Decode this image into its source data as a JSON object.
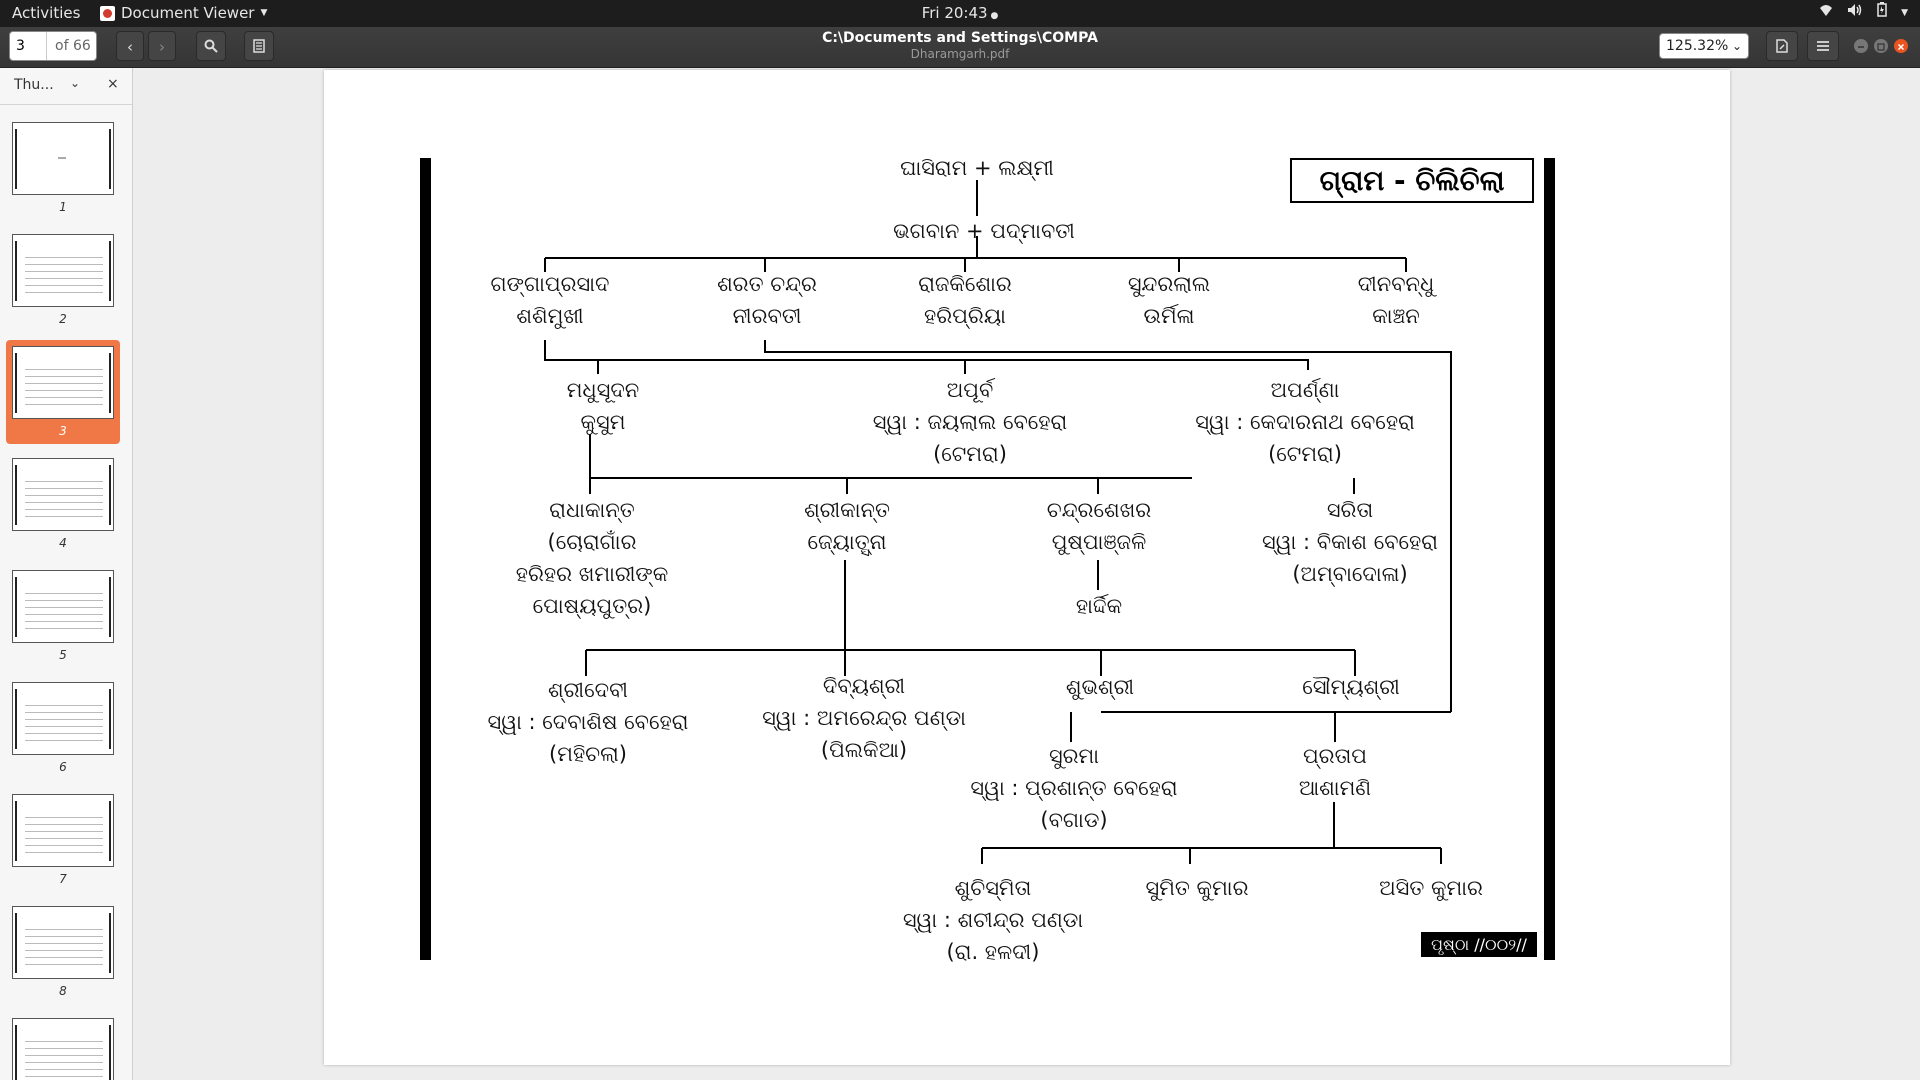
{
  "topbar": {
    "activities": "Activities",
    "app_name": "Document Viewer",
    "clock": "Fri 20:43",
    "app_menu_icon": "chevron-down-icon",
    "tray_icons": [
      "wifi-icon",
      "volume-icon",
      "battery-icon",
      "power-menu-icon"
    ]
  },
  "toolbar": {
    "page_current": "3",
    "page_total": "of 66",
    "title": "C:\\Documents and Settings\\COMPA",
    "subtitle": "Dharamgarh.pdf",
    "zoom": "125.32%"
  },
  "sidebar": {
    "mode_label": "Thu...",
    "thumbnails": [
      "1",
      "2",
      "3",
      "4",
      "5",
      "6",
      "7",
      "8"
    ],
    "selected": "3"
  },
  "document": {
    "village_title": "ଗ୍ରାମ - ଚିଲିଚିଲା",
    "page_label": "ପୃଷ୍ଠା //୦୦୨//",
    "nodes": {
      "n1": "ଘାସିରାମ + ଲକ୍ଷ୍ମୀ",
      "n2": "ଭଗବାନ + ପଦ୍ମାବତୀ",
      "n3a": "ଗଙ୍ଗାପ୍ରସାଦ",
      "n3b": "ଶଶିମୁଖୀ",
      "n4a": "ଶରତ ଚନ୍ଦ୍ର",
      "n4b": "ନୀରବତୀ",
      "n5a": "ରାଜକିଶୋର",
      "n5b": "ହରିପ୍ରିୟା",
      "n6a": "ସୁନ୍ଦରଲାଲ",
      "n6b": "ଉର୍ମିଳା",
      "n7a": "ଦୀନବନ୍ଧୁ",
      "n7b": "କାଞ୍ଚନ",
      "n8a": "ମଧୁସୂଦନ",
      "n8b": "କୁସୁମ",
      "n9a": "ଅପୂର୍ବ",
      "n9b": "ସ୍ୱା : ଜୟଲାଲ ବେହେରା",
      "n9c": "(ଟେମରା)",
      "n10a": "ଅପର୍ଣ୍ଣା",
      "n10b": "ସ୍ୱା : କେଦାରନାଥ ବେହେରା",
      "n10c": "(ଟେମରା)",
      "n11a": "ରାଧାକାନ୍ତ",
      "n11b": "(ଚୋରାଗାଁର",
      "n11c": "ହରିହର ଖମାରୀଙ୍କ",
      "n11d": "ପୋଷ୍ୟପୁତ୍ର)",
      "n12a": "ଶ୍ରୀକାନ୍ତ",
      "n12b": "ଜ୍ୟୋତ୍ସ୍ନା",
      "n13a": "ଚନ୍ଦ୍ରଶେଖର",
      "n13b": "ପୁଷ୍ପାଞ୍ଜଳି",
      "n14": "ହାର୍ଦ୍ଦିକ",
      "n15a": "ସରିତା",
      "n15b": "ସ୍ୱା : ବିକାଶ ବେହେରା",
      "n15c": "(ଅମ୍ବାଦୋଳା)",
      "n16a": "ଶ୍ରୀଦେବୀ",
      "n16b": "ସ୍ୱା : ଦେବାଶିଷ ବେହେରା",
      "n16c": "(ମହିଚଲା)",
      "n17a": "ଦିବ୍ୟଶ୍ରୀ",
      "n17b": "ସ୍ୱା : ଅମରେନ୍ଦ୍ର ପଣ୍ଡା",
      "n17c": "(ପିଲକିଆ)",
      "n18": "ଶୁଭଶ୍ରୀ",
      "n19": "ସୌମ୍ୟଶ୍ରୀ",
      "n20a": "ସୁରମା",
      "n20b": "ସ୍ୱା : ପ୍ରଶାନ୍ତ ବେହେରା",
      "n20c": "(ବଗାଡ)",
      "n21a": "ପ୍ରତାପ",
      "n21b": "ଆଶାମଣି",
      "n22a": "ଶୁଚିସ୍ମିତା",
      "n22b": "ସ୍ୱା : ଶଚୀନ୍ଦ୍ର ପଣ୍ଡା",
      "n22c": "(ରା. ହଳଦୀ)",
      "n23": "ସୁମିତ କୁମାର",
      "n24": "ଅସିତ କୁମାର"
    }
  }
}
